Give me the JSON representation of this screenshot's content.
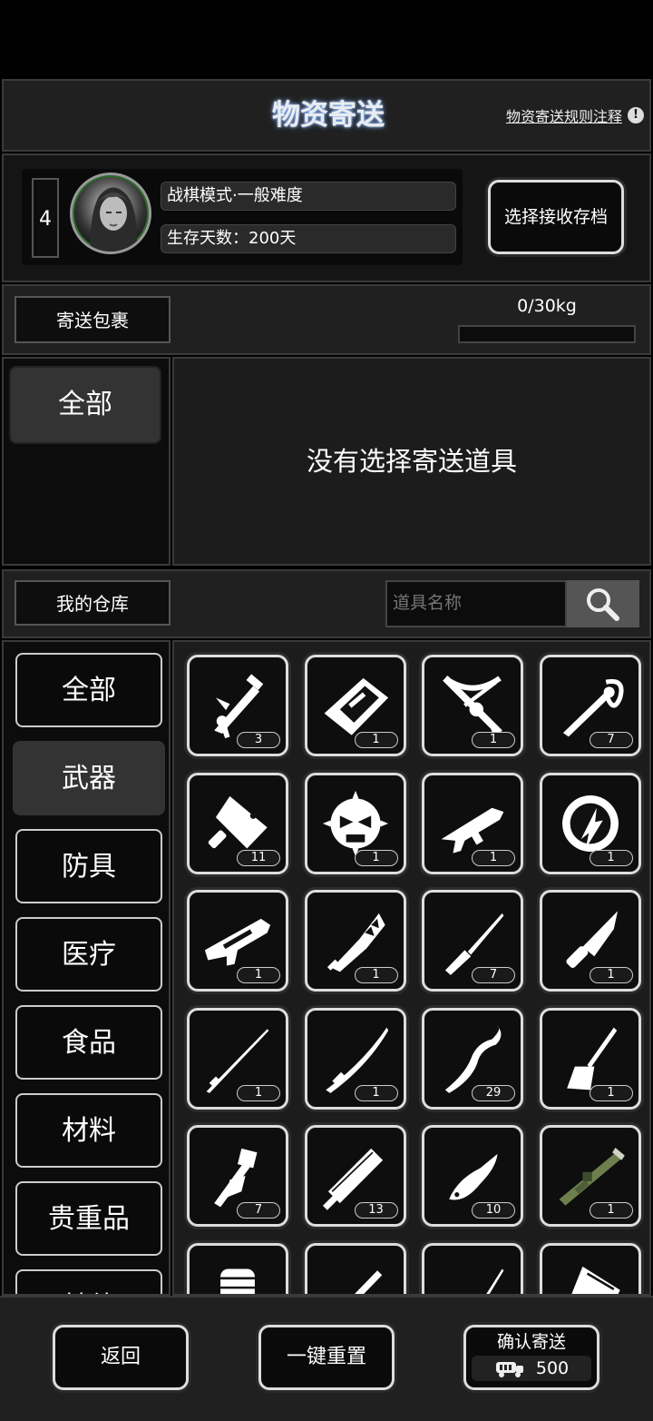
{
  "header": {
    "title": "物资寄送",
    "rules_link": "物资寄送规则注释",
    "rules_icon": "!"
  },
  "profile": {
    "slot_number": "4",
    "mode": "战棋模式·一般难度",
    "days": "生存天数：200天",
    "select_save_label": "选择接收存档"
  },
  "package": {
    "tab_label": "寄送包裹",
    "weight": "0/30kg",
    "weight_fraction": 0,
    "filter_all": "全部",
    "empty_message": "没有选择寄送道具"
  },
  "warehouse": {
    "tab_label": "我的仓库",
    "search_placeholder": "道具名称",
    "categories": [
      "全部",
      "武器",
      "防具",
      "医疗",
      "食品",
      "材料",
      "贵重品",
      "其他"
    ],
    "selected_category": "武器",
    "items": [
      {
        "icon": "spray-gun-icon",
        "count": "3"
      },
      {
        "icon": "blade-gauntlet-icon",
        "count": "1"
      },
      {
        "icon": "crossbow-icon",
        "count": "1"
      },
      {
        "icon": "sabre-icon",
        "count": "7"
      },
      {
        "icon": "cleaver-icon",
        "count": "11"
      },
      {
        "icon": "spiked-mask-icon",
        "count": "1"
      },
      {
        "icon": "assault-rifle-icon",
        "count": "1"
      },
      {
        "icon": "electric-sawblade-icon",
        "count": "1"
      },
      {
        "icon": "heavy-rifle-icon",
        "count": "1"
      },
      {
        "icon": "serrated-blade-icon",
        "count": "1"
      },
      {
        "icon": "screwdriver-icon",
        "count": "7"
      },
      {
        "icon": "hunting-knife-icon",
        "count": "1"
      },
      {
        "icon": "long-spike-icon",
        "count": "1"
      },
      {
        "icon": "katana-icon",
        "count": "1"
      },
      {
        "icon": "twisted-staff-icon",
        "count": "29"
      },
      {
        "icon": "shovel-icon",
        "count": "1"
      },
      {
        "icon": "fire-axe-icon",
        "count": "7"
      },
      {
        "icon": "broadsword-icon",
        "count": "13"
      },
      {
        "icon": "folding-knife-icon",
        "count": "10"
      },
      {
        "icon": "rocket-launcher-icon",
        "count": "1"
      },
      {
        "icon": "power-fist-icon",
        "count": ""
      },
      {
        "icon": "syringe-gun-icon",
        "count": ""
      },
      {
        "icon": "thin-spike-icon",
        "count": ""
      },
      {
        "icon": "riot-shield-icon",
        "count": ""
      }
    ]
  },
  "footer": {
    "back_label": "返回",
    "reset_label": "一键重置",
    "confirm_label": "确认寄送",
    "cost": "500"
  }
}
